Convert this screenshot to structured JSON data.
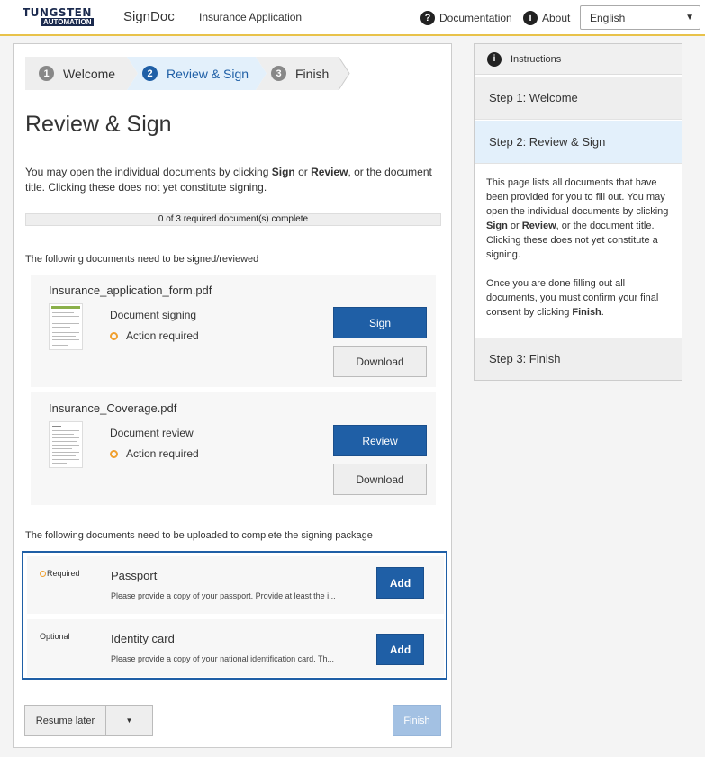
{
  "header": {
    "logo_top": "TUNGSTEN",
    "logo_bottom": "AUTOMATION",
    "app_name": "SignDoc",
    "sub_name": "Insurance Application",
    "documentation": "Documentation",
    "about": "About",
    "language": "English"
  },
  "steps": [
    {
      "num": "1",
      "label": "Welcome"
    },
    {
      "num": "2",
      "label": "Review & Sign"
    },
    {
      "num": "3",
      "label": "Finish"
    }
  ],
  "page_title": "Review & Sign",
  "intro": {
    "t1": "You may open the individual documents by clicking ",
    "sign": "Sign",
    "t2": " or ",
    "review": "Review",
    "t3": ", or the document title. Clicking these does not yet constitute signing."
  },
  "progress": "0 of 3 required document(s) complete",
  "section_sign": "The following documents need to be signed/reviewed",
  "documents": [
    {
      "title": "Insurance_application_form.pdf",
      "type": "Document signing",
      "status": "Action required",
      "action": "Sign",
      "download": "Download"
    },
    {
      "title": "Insurance_Coverage.pdf",
      "type": "Document review",
      "status": "Action required",
      "action": "Review",
      "download": "Download"
    }
  ],
  "section_upload": "The following documents need to be uploaded to complete the signing package",
  "uploads": [
    {
      "tag": "Required",
      "name": "Passport",
      "desc": "Please provide a copy of your passport. Provide at least the i...",
      "action": "Add"
    },
    {
      "tag": "Optional",
      "name": "Identity card",
      "desc": "Please provide a copy of your national identification card. Th...",
      "action": "Add"
    }
  ],
  "footer": {
    "resume": "Resume later",
    "finish": "Finish"
  },
  "sidebar": {
    "title": "Instructions",
    "step1": "Step 1: Welcome",
    "step2": "Step 2: Review & Sign",
    "step3": "Step 3: Finish",
    "p1a": "This page lists all documents that have been provided for you to fill out. You may open the individual documents by clicking ",
    "p1_sign": "Sign",
    "p1b": " or ",
    "p1_review": "Review",
    "p1c": ", or the document title. Clicking these does not yet constitute a signing.",
    "p2a": "Once you are done filling out all documents, you must confirm your final consent by clicking ",
    "p2_finish": "Finish",
    "p2b": "."
  },
  "colors": {
    "primary": "#1f5fa6",
    "accent": "#e8c24a",
    "warning": "#f0a030"
  }
}
